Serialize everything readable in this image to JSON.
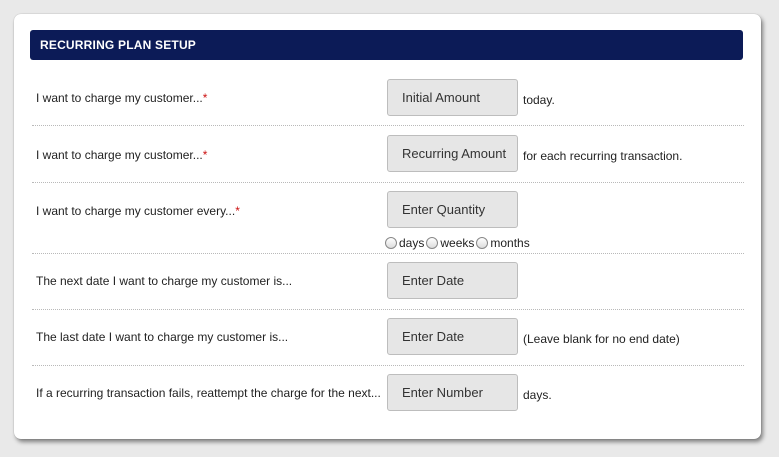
{
  "header": {
    "title": "RECURRING PLAN SETUP"
  },
  "rows": [
    {
      "label": "I want to charge my customer...",
      "required": "*",
      "placeholder": "Initial Amount",
      "suffix": "today."
    },
    {
      "label": "I want to charge my customer...",
      "required": "*",
      "placeholder": "Recurring Amount",
      "suffix": "for each recurring transaction."
    },
    {
      "label": "I want to charge my customer every...",
      "required": "*",
      "placeholder": "Enter Quantity",
      "suffix": ""
    },
    {
      "label": "The next date I want to charge my customer is...",
      "required": "",
      "placeholder": "Enter Date",
      "suffix": ""
    },
    {
      "label": "The last date I want to charge my customer is...",
      "required": "",
      "placeholder": "Enter Date",
      "suffix": "(Leave blank for no end date)"
    },
    {
      "label": "If a recurring transaction fails, reattempt the charge for the next...",
      "required": "",
      "placeholder": "Enter Number",
      "suffix": "days."
    }
  ],
  "frequency_options": [
    "days",
    "weeks",
    "months"
  ],
  "colors": {
    "header_bg": "#0c1b57",
    "required": "#cc1111",
    "field_bg": "#e6e6e6"
  }
}
